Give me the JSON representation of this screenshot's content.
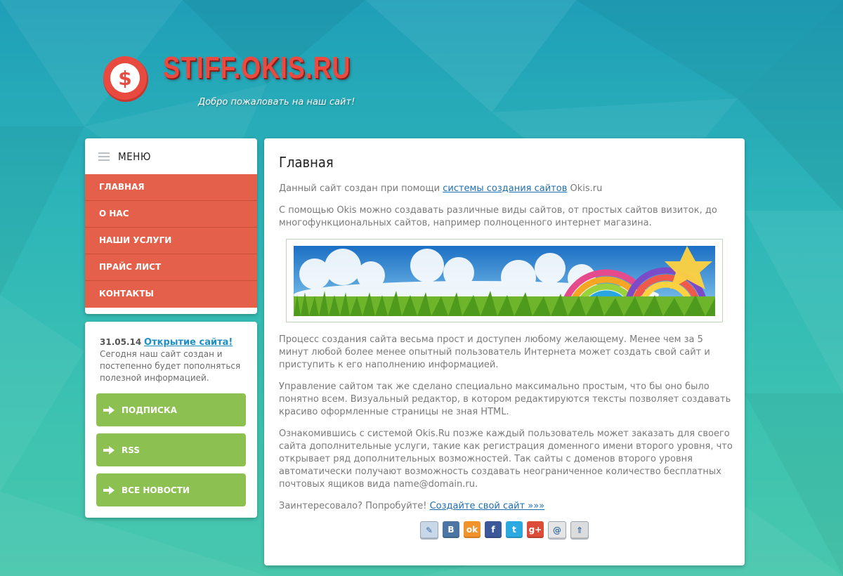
{
  "header": {
    "site_title": "STIFF.OKIS.RU",
    "tagline": "Добро пожаловать на наш сайт!",
    "logo_symbol": "$"
  },
  "menu": {
    "title": "МЕНЮ",
    "items": [
      {
        "label": "ГЛАВНАЯ"
      },
      {
        "label": "О НАС"
      },
      {
        "label": "НАШИ УСЛУГИ"
      },
      {
        "label": "ПРАЙС ЛИСТ"
      },
      {
        "label": "КОНТАКТЫ"
      }
    ]
  },
  "news": {
    "date": "31.05.14",
    "link": "Открытие сайта!",
    "text": "Сегодня наш сайт создан и постепенно будет пополняться полезной информацией."
  },
  "buttons": {
    "subscribe": "ПОДПИСКА",
    "rss": "RSS",
    "all_news": "ВСЕ НОВОСТИ"
  },
  "content": {
    "title": "Главная",
    "intro_before": "Данный сайт создан при помощи ",
    "intro_link": "системы создания сайтов",
    "intro_after": " Okis.ru",
    "p1": "С помощью Okis можно создавать различные виды сайтов, от простых сайтов визиток, до многофункциональных сайтов, например полноценного интернет магазина.",
    "p2": "Процесс создания сайта весьма прост и доступен любому желающему. Менее чем за 5 минут любой более менее опытный пользователь Интернета может создать свой сайт и приступить к его наполнению информацией.",
    "p3": "Управление сайтом так же сделано специально максимально простым, что бы оно было понятно всем. Визуальный редактор, в котором редактируются тексты позволяет создавать красиво оформленные страницы не зная HTML.",
    "p4": "Ознакомившись с системой Okis.Ru позже каждый пользователь может заказать для своего сайта дополнительные услуги, такие как регистрация доменного имени второго уровня, что открывает ряд дополнительных возможностей. Так сайты с доменов второго уровня автоматически получают возможность создавать неограниченное количество бесплатных почтовых ящиков вида name@domain.ru.",
    "cta_before": "Заинтересовало? Попробуйте! ",
    "cta_link": "Создайте свой сайт »»»"
  },
  "share": [
    {
      "icon": "livejournal-icon",
      "glyph": "✎",
      "color": "#c8d8e8"
    },
    {
      "icon": "vkontakte-icon",
      "glyph": "B",
      "color": "#4c75a3"
    },
    {
      "icon": "odnoklassniki-icon",
      "glyph": "ok",
      "color": "#f2922a"
    },
    {
      "icon": "facebook-icon",
      "glyph": "f",
      "color": "#3b5998"
    },
    {
      "icon": "twitter-icon",
      "glyph": "t",
      "color": "#2ba9e1"
    },
    {
      "icon": "google-plus-icon",
      "glyph": "g+",
      "color": "#dd4b39"
    },
    {
      "icon": "mail-ru-icon",
      "glyph": "@",
      "color": "#e5e5e5"
    },
    {
      "icon": "more-share-icon",
      "glyph": "⇑",
      "color": "#dcdcdc"
    }
  ],
  "colors": {
    "accent_red": "#e4604a",
    "accent_green": "#8cc152",
    "link_blue": "#1f6fb0",
    "title_red": "#ea4a40"
  }
}
